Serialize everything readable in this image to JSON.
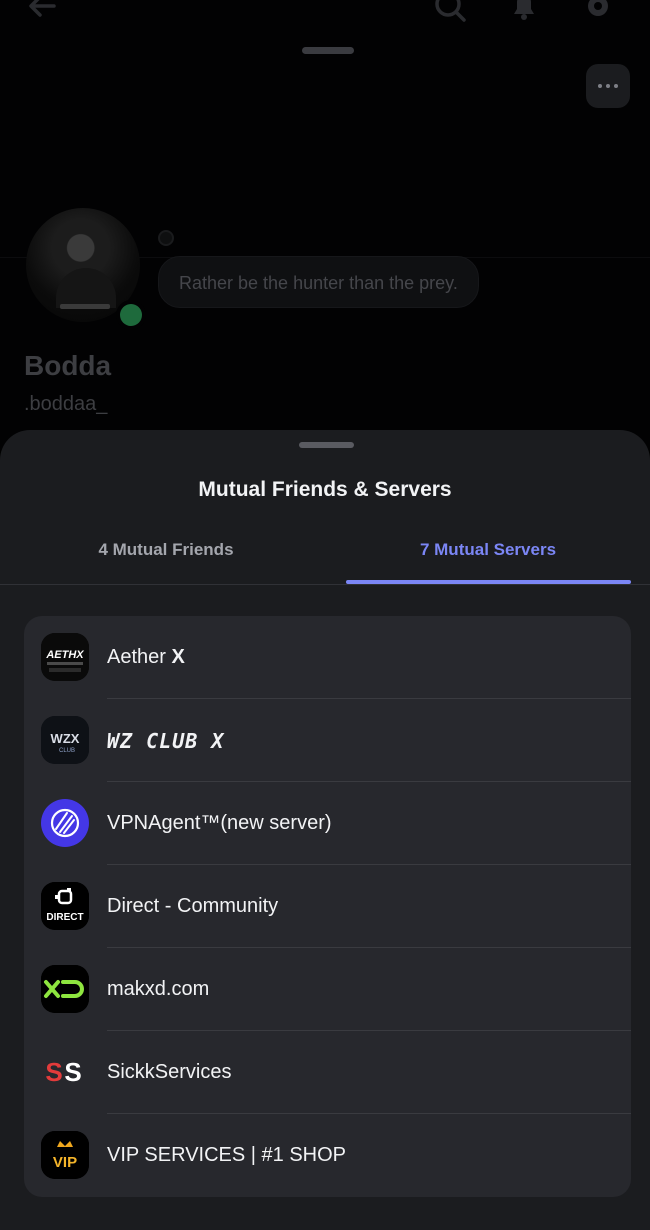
{
  "profile": {
    "status_text": "Rather be the hunter than the prey.",
    "display_name": "Bodda",
    "username": ".boddaa_"
  },
  "sheet": {
    "title": "Mutual Friends & Servers",
    "tabs": [
      {
        "label": "4 Mutual Friends",
        "active": false
      },
      {
        "label": "7 Mutual Servers",
        "active": true
      }
    ]
  },
  "servers": [
    {
      "name": "Aether X",
      "icon": "aethx-logo",
      "icon_text": "AETHX"
    },
    {
      "name": "WZ CLUB X",
      "icon": "wzx-club-logo",
      "icon_text": "WZX"
    },
    {
      "name": "VPNAgent™(new server)",
      "icon": "vpnagent-logo",
      "icon_text": ""
    },
    {
      "name": "Direct - Community",
      "icon": "direct-logo",
      "icon_text": "DIRECT"
    },
    {
      "name": "makxd.com",
      "icon": "xd-logo",
      "icon_text": "XD"
    },
    {
      "name": "SickkServices",
      "icon": "ss-logo",
      "icon_text": "SS"
    },
    {
      "name": "VIP SERVICES | #1 SHOP",
      "icon": "vip-logo",
      "icon_text": "VIP"
    }
  ],
  "colors": {
    "accent": "#7b86f5",
    "sheet_bg": "#1b1c1f",
    "card_bg": "#27282d",
    "online": "#1e6a3c"
  }
}
